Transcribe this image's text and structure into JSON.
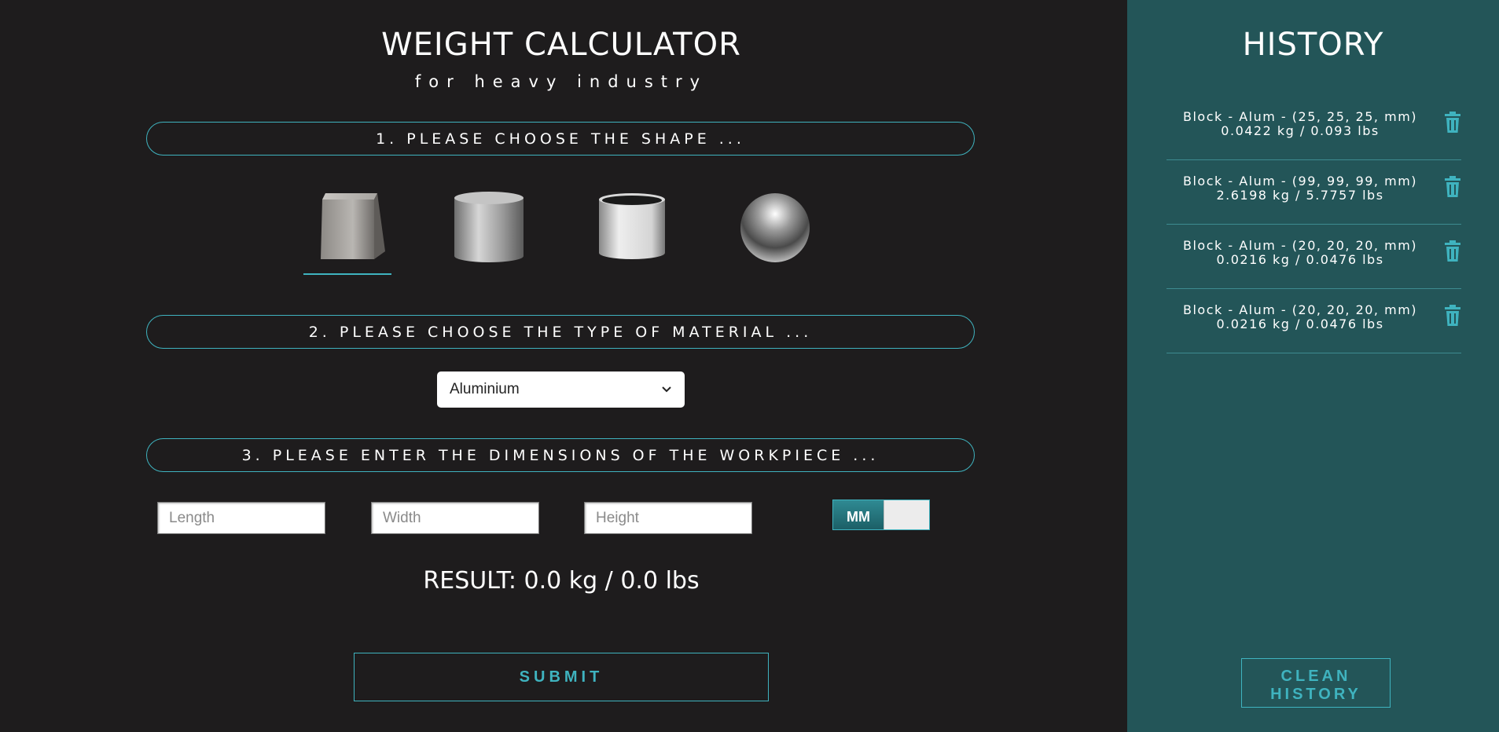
{
  "header": {
    "title": "WEIGHT CALCULATOR",
    "subtitle": "for heavy industry"
  },
  "steps": {
    "shape": "1. PLEASE CHOOSE THE SHAPE ...",
    "material": "2. PLEASE CHOOSE THE TYPE OF MATERIAL ...",
    "dimensions": "3. PLEASE ENTER THE DIMENSIONS OF THE WORKPIECE ..."
  },
  "shapes": [
    {
      "name": "block",
      "icon": "cube-icon",
      "selected": true
    },
    {
      "name": "cylinder",
      "icon": "cylinder-icon",
      "selected": false
    },
    {
      "name": "tube",
      "icon": "tube-icon",
      "selected": false
    },
    {
      "name": "sphere",
      "icon": "sphere-icon",
      "selected": false
    }
  ],
  "material": {
    "selected": "Aluminium"
  },
  "inputs": {
    "length_placeholder": "Length",
    "width_placeholder": "Width",
    "height_placeholder": "Height"
  },
  "unit_toggle": {
    "label": "MM"
  },
  "result": "RESULT: 0.0 kg / 0.0 lbs",
  "submit_label": "SUBMIT",
  "history": {
    "title": "HISTORY",
    "items": [
      {
        "line1": "Block - Alum - (25, 25, 25, mm)",
        "line2": "0.0422 kg / 0.093 lbs"
      },
      {
        "line1": "Block - Alum - (99, 99, 99, mm)",
        "line2": "2.6198 kg / 5.7757 lbs"
      },
      {
        "line1": "Block - Alum - (20, 20, 20, mm)",
        "line2": "0.0216 kg / 0.0476 lbs"
      },
      {
        "line1": "Block - Alum - (20, 20, 20, mm)",
        "line2": "0.0216 kg / 0.0476 lbs"
      }
    ],
    "clean_label_1": "CLEAN",
    "clean_label_2": "HISTORY"
  },
  "colors": {
    "accent": "#3fb3bf",
    "background": "#1e1c1d",
    "history_bg": "#235558"
  }
}
